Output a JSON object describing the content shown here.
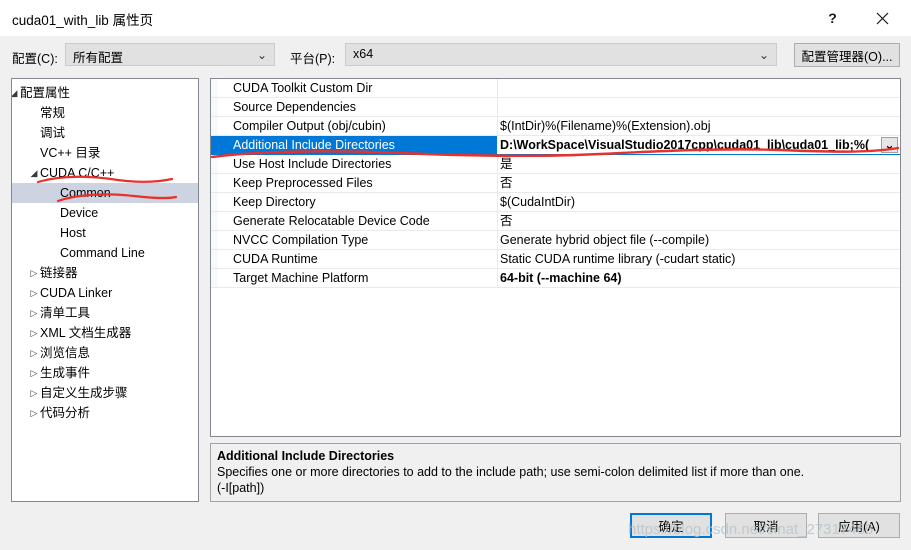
{
  "window": {
    "title": "cuda01_with_lib 属性页",
    "help_label": "?",
    "close_label": "✕",
    "accent_color": "#0078d7",
    "tree_selection_color": "#cdd3e1",
    "annotation_color": "#e8312a"
  },
  "config_bar": {
    "config_label": "配置(C):",
    "config_value": "所有配置",
    "platform_label": "平台(P):",
    "platform_value": "x64",
    "config_manager_label": "配置管理器(O)...",
    "dropdown_glyph": "⌄"
  },
  "tree": {
    "items": [
      {
        "label": "配置属性",
        "indent": 0,
        "arrow": "expanded",
        "selected": false
      },
      {
        "label": "常规",
        "indent": 1,
        "arrow": "none",
        "selected": false
      },
      {
        "label": "调试",
        "indent": 1,
        "arrow": "none",
        "selected": false
      },
      {
        "label": "VC++ 目录",
        "indent": 1,
        "arrow": "none",
        "selected": false
      },
      {
        "label": "CUDA C/C++",
        "indent": 1,
        "arrow": "expanded",
        "selected": false
      },
      {
        "label": "Common",
        "indent": 2,
        "arrow": "none",
        "selected": true
      },
      {
        "label": "Device",
        "indent": 2,
        "arrow": "none",
        "selected": false
      },
      {
        "label": "Host",
        "indent": 2,
        "arrow": "none",
        "selected": false
      },
      {
        "label": "Command Line",
        "indent": 2,
        "arrow": "none",
        "selected": false
      },
      {
        "label": "链接器",
        "indent": 1,
        "arrow": "collapsed",
        "selected": false
      },
      {
        "label": "CUDA Linker",
        "indent": 1,
        "arrow": "collapsed",
        "selected": false
      },
      {
        "label": "清单工具",
        "indent": 1,
        "arrow": "collapsed",
        "selected": false
      },
      {
        "label": "XML 文档生成器",
        "indent": 1,
        "arrow": "collapsed",
        "selected": false
      },
      {
        "label": "浏览信息",
        "indent": 1,
        "arrow": "collapsed",
        "selected": false
      },
      {
        "label": "生成事件",
        "indent": 1,
        "arrow": "collapsed",
        "selected": false
      },
      {
        "label": "自定义生成步骤",
        "indent": 1,
        "arrow": "collapsed",
        "selected": false
      },
      {
        "label": "代码分析",
        "indent": 1,
        "arrow": "collapsed",
        "selected": false
      }
    ],
    "arrow_expanded_glyph": "◢",
    "arrow_collapsed_glyph": "▷"
  },
  "property_grid": {
    "rows": [
      {
        "name": "CUDA Toolkit Custom Dir",
        "value": "",
        "selected": false,
        "bold": false
      },
      {
        "name": "Source Dependencies",
        "value": "",
        "selected": false,
        "bold": false
      },
      {
        "name": "Compiler Output (obj/cubin)",
        "value": "$(IntDir)%(Filename)%(Extension).obj",
        "selected": false,
        "bold": false
      },
      {
        "name": "Additional Include Directories",
        "value": "D:\\WorkSpace\\VisualStudio2017cpp\\cuda01_lib\\cuda01_lib;%(",
        "selected": true,
        "bold": true
      },
      {
        "name": "Use Host Include Directories",
        "value": "是",
        "selected": false,
        "bold": false
      },
      {
        "name": "Keep Preprocessed Files",
        "value": "否",
        "selected": false,
        "bold": false
      },
      {
        "name": "Keep Directory",
        "value": "$(CudaIntDir)",
        "selected": false,
        "bold": false
      },
      {
        "name": "Generate Relocatable Device Code",
        "value": "否",
        "selected": false,
        "bold": false
      },
      {
        "name": "NVCC Compilation Type",
        "value": "Generate hybrid object file (--compile)",
        "selected": false,
        "bold": false
      },
      {
        "name": "CUDA Runtime",
        "value": "Static CUDA runtime library (-cudart static)",
        "selected": false,
        "bold": false
      },
      {
        "name": "Target Machine Platform",
        "value": "64-bit (--machine 64)",
        "selected": false,
        "bold": true
      }
    ],
    "editor_dropdown_glyph": "⌄"
  },
  "description": {
    "title": "Additional Include Directories",
    "line1": "Specifies one or more directories to add to the include path; use semi-colon delimited list if more than one.",
    "line2": "(-I[path])"
  },
  "footer": {
    "ok_label": "确定",
    "cancel_label": "取消",
    "apply_label": "应用(A)"
  },
  "watermark": {
    "text": "https://blog.csdn.net/sinat_27317465"
  }
}
